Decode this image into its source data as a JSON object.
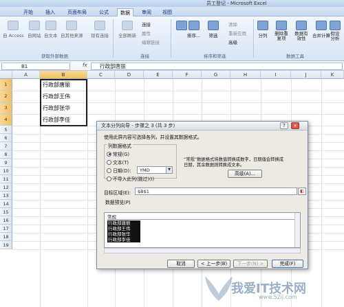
{
  "window": {
    "title": "员工登记 - Microsoft Excel"
  },
  "menu": {
    "tabs": [
      "开始",
      "插入",
      "页面布局",
      "公式",
      "数据",
      "审阅",
      "视图"
    ],
    "active": "数据"
  },
  "ribbon": {
    "external": {
      "access": "自 Access",
      "web": "自网站",
      "text": "自文本",
      "other": "自其他来源",
      "existing": "现有连接",
      "label": "获取外部数据"
    },
    "connections": {
      "refresh": "全部刷新",
      "conn": "连接",
      "props": "属性",
      "edit": "编辑链接",
      "label": "连接"
    },
    "sort": {
      "sort": "排序...",
      "filter": "筛选",
      "clear": "清除",
      "reapply": "重新应用",
      "advanced": "高级",
      "label": "排序和筛选"
    },
    "tools": {
      "split": "分列",
      "dedupe": "删除重复项",
      "validation": "数据有效性",
      "consolidate": "合并计算",
      "whatif": "假设分析",
      "label": "数据工具"
    }
  },
  "formula": {
    "namebox": "B1",
    "fx": "fx",
    "value": "行政部唐丽"
  },
  "columns": [
    "A",
    "B",
    "C",
    "D",
    "E",
    "F",
    "G",
    "H",
    "I",
    "J",
    "K"
  ],
  "rows": [
    "1",
    "2",
    "3",
    "4",
    "5",
    "6",
    "7",
    "8",
    "9",
    "10",
    "11",
    "12",
    "13",
    "14",
    "15",
    "16",
    "17",
    "18",
    "19"
  ],
  "cells": [
    "行政部唐丽",
    "行政部王伟",
    "行政部张华",
    "行政部李佳"
  ],
  "dialog": {
    "title": "文本分列向导 - 步骤之 3 (共 3 步)",
    "help": "?",
    "close": "×",
    "intro": "使用此屏内容可选择各列，并设置其数据格式。",
    "format_label": "列数据格式",
    "options": [
      "常规(G)",
      "文本(T)",
      "日期(D):",
      "不导入此列(跳过)(I)"
    ],
    "date_format": "YMD",
    "desc1": "“常规”数据格式将数值转换成数字，日期值会转换成",
    "desc2": "日期，其余数据则转换成文本。",
    "advanced": "高级(A)...",
    "dest_label": "目标区域(E):",
    "dest_value": "$B$1",
    "preview_label": "数据预览(P)",
    "preview_header": "常规",
    "cancel": "取消",
    "back": "< 上一步(B)",
    "next": "下一步(N) >",
    "finish": "完成(F)"
  },
  "watermark": {
    "brand": "我爱IT技术网",
    "url": "www.52ij.com"
  }
}
